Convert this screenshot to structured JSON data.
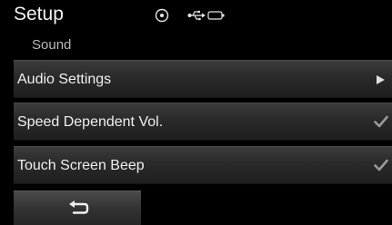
{
  "header": {
    "title": "Setup",
    "status_icons": [
      "disc-icon",
      "usb-icon",
      "battery-icon"
    ]
  },
  "subheader": {
    "label": "Sound"
  },
  "menu": {
    "items": [
      {
        "label": "Audio Settings",
        "indicator": "arrow-right-icon"
      },
      {
        "label": "Speed Dependent Vol.",
        "indicator": "checkmark-icon",
        "checked": true
      },
      {
        "label": "Touch Screen Beep",
        "indicator": "checkmark-icon",
        "checked": true
      }
    ]
  },
  "footer": {
    "back_icon": "back-arrow-icon"
  },
  "colors": {
    "background": "#000000",
    "row": "#2a2a2a",
    "text": "#f0f0f0",
    "subtext": "#b8b8b8",
    "check": "#9a9a9a"
  }
}
